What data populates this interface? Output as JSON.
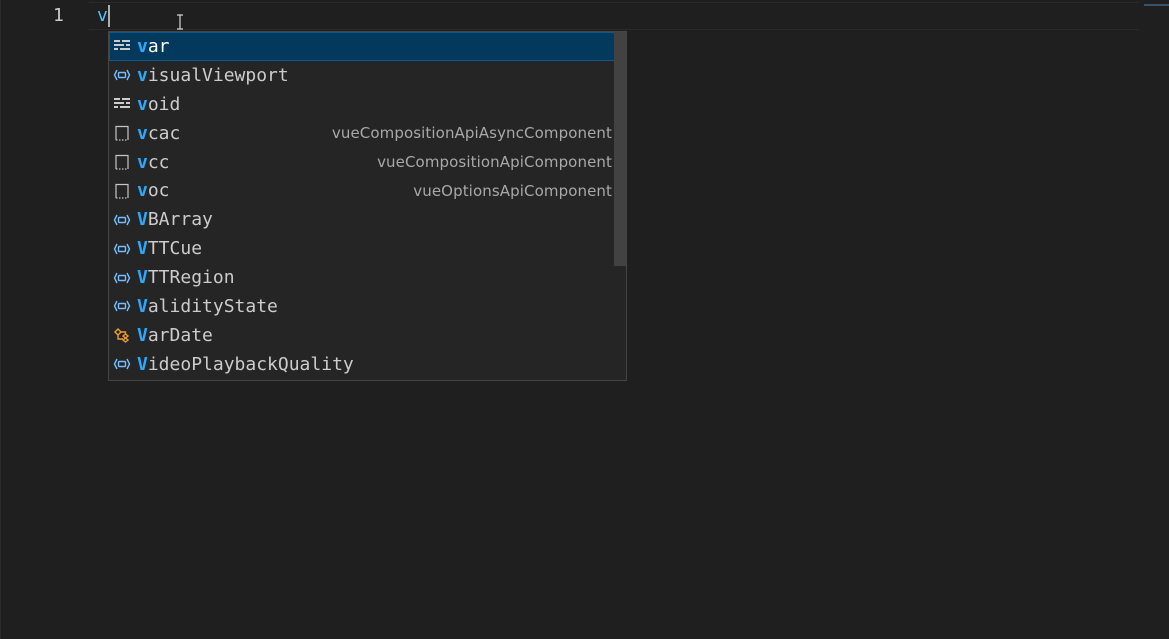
{
  "editor": {
    "line_number": "1",
    "typed_text": "v",
    "colors": {
      "background": "#1f1f1f",
      "match_highlight": "#2aaaff",
      "selected_row": "#04395e",
      "variable_icon": "#75beff",
      "keyword_icon": "#cccccc",
      "class_icon": "#ee9d28"
    }
  },
  "suggest": {
    "items": [
      {
        "match": "v",
        "rest": "ar",
        "detail": "",
        "icon": "keyword-icon",
        "selected": true
      },
      {
        "match": "v",
        "rest": "isualViewport",
        "detail": "",
        "icon": "variable-icon"
      },
      {
        "match": "v",
        "rest": "oid",
        "detail": "",
        "icon": "keyword-icon"
      },
      {
        "match": "v",
        "rest": "cac",
        "detail": "vueCompositionApiAsyncComponent",
        "icon": "snippet-icon"
      },
      {
        "match": "v",
        "rest": "cc",
        "detail": "vueCompositionApiComponent",
        "icon": "snippet-icon"
      },
      {
        "match": "v",
        "rest": "oc",
        "detail": "vueOptionsApiComponent",
        "icon": "snippet-icon"
      },
      {
        "match": "V",
        "rest": "BArray",
        "detail": "",
        "icon": "variable-icon"
      },
      {
        "match": "V",
        "rest": "TTCue",
        "detail": "",
        "icon": "variable-icon"
      },
      {
        "match": "V",
        "rest": "TTRegion",
        "detail": "",
        "icon": "variable-icon"
      },
      {
        "match": "V",
        "rest": "alidityState",
        "detail": "",
        "icon": "variable-icon"
      },
      {
        "match": "V",
        "rest": "arDate",
        "detail": "",
        "icon": "class-icon"
      },
      {
        "match": "V",
        "rest": "ideoPlaybackQuality",
        "detail": "",
        "icon": "variable-icon"
      }
    ]
  }
}
